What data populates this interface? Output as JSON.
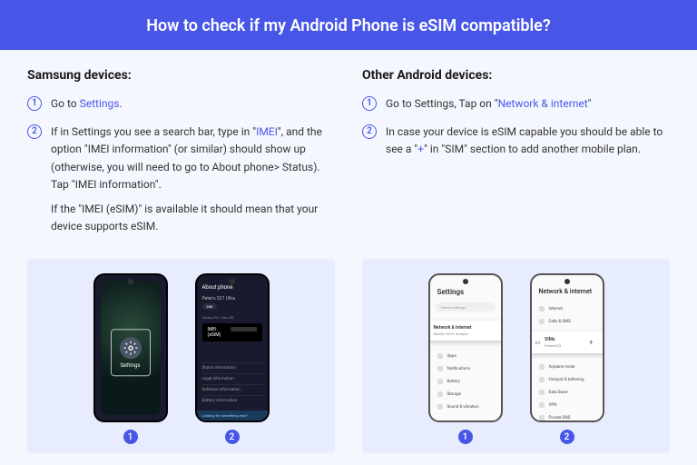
{
  "header": {
    "title": "How to check if my Android Phone is eSIM compatible?"
  },
  "samsung": {
    "heading": "Samsung devices:",
    "step1_pre": "Go to ",
    "step1_link": "Settings",
    "step1_post": ".",
    "step2_pre": "If in Settings you see a search bar, type in \"",
    "step2_link": "IMEI",
    "step2_post": "\", and the option \"IMEI information\" (or similar) should show up (otherwise, you will need to go to About phone> Status). Tap \"IMEI information\".",
    "step2_extra": "If the \"IMEI (eSIM)\" is available it should mean that your device supports eSIM.",
    "phone1": {
      "icon_label": "Settings"
    },
    "phone2": {
      "screen_title": "About phone",
      "device_name": "Peter's S21 Ultra",
      "edit": "Edit",
      "model_line": "Galaxy S21 Ultra 5G",
      "imei_label": "IMEI (eSIM)",
      "list1": "Status information",
      "list2": "Legal information",
      "list3": "Software information",
      "list4": "Battery information",
      "footer": "Looking for something else?"
    }
  },
  "other": {
    "heading": "Other Android devices:",
    "step1_pre": "Go to Settings, Tap on \"",
    "step1_link": "Network & internet",
    "step1_post": "\"",
    "step2_pre": "In case your device is eSIM capable you should be able to see a \"",
    "step2_link": "+",
    "step2_post": "\" in \"SIM\" section to add another mobile plan.",
    "phone1": {
      "title": "Settings",
      "search": "Search settings",
      "popup_title": "Network & Internet",
      "popup_sub": "Mobile, Wi-Fi, hotspot",
      "i1": "Apps",
      "i2": "Notifications",
      "i3": "Battery",
      "i4": "Storage",
      "i5": "Sound & vibration"
    },
    "phone2": {
      "title": "Network & internet",
      "i1": "Internet",
      "i2": "Calls & SMS",
      "popup_title": "SIMs",
      "popup_sub": "Roshtel23",
      "plus": "+",
      "i3": "Airplane mode",
      "i4": "Hotspot & tethering",
      "i5": "Data Saver",
      "i6": "VPN",
      "i7": "Private DNS"
    }
  },
  "captions": {
    "c1": "1",
    "c2": "2"
  }
}
